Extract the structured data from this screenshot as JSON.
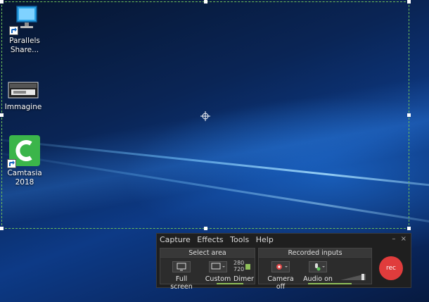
{
  "desktop": {
    "icons": [
      {
        "label": "Parallels Share..."
      },
      {
        "label": "Immagine"
      },
      {
        "label": "Camtasia 2018"
      }
    ]
  },
  "recorder": {
    "menu": [
      "Capture",
      "Effects",
      "Tools",
      "Help"
    ],
    "window_controls": {
      "minimize": "–",
      "close": "×"
    },
    "select_area": {
      "title": "Select area",
      "full_screen": "Full screen",
      "custom": "Custom",
      "width": "280",
      "height": "720",
      "dimensions": "Dimer"
    },
    "recorded_inputs": {
      "title": "Recorded inputs",
      "camera": "Camera off",
      "audio": "Audio on"
    },
    "rec_label": "rec",
    "colors": {
      "rec": "#e03c3c",
      "selection_border": "#6fbf5a",
      "panel": "#1f1f1f"
    }
  }
}
